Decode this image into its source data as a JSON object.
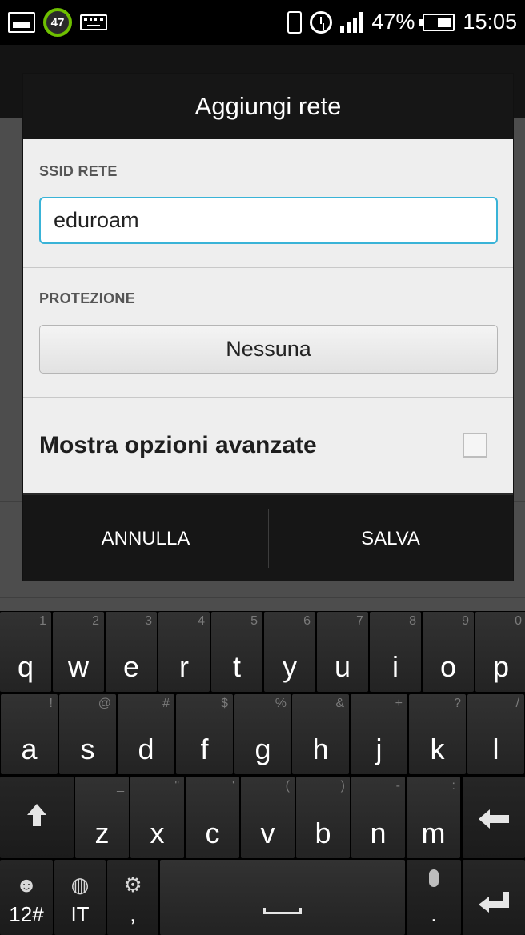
{
  "status_bar": {
    "notification_count": "47",
    "battery_percent": "47%",
    "time": "15:05",
    "icons": [
      "image-icon",
      "task-counter-icon",
      "keyboard-icon",
      "vibrate-icon",
      "alarm-icon",
      "signal-icon",
      "battery-icon"
    ]
  },
  "dialog": {
    "title": "Aggiungi rete",
    "ssid_label": "SSID RETE",
    "ssid_value": "eduroam",
    "protection_label": "PROTEZIONE",
    "protection_value": "Nessuna",
    "advanced_label": "Mostra opzioni avanzate",
    "advanced_checked": false,
    "cancel_label": "ANNULLA",
    "save_label": "SALVA"
  },
  "keyboard": {
    "row1": [
      {
        "k": "q",
        "s": "1"
      },
      {
        "k": "w",
        "s": "2"
      },
      {
        "k": "e",
        "s": "3"
      },
      {
        "k": "r",
        "s": "4"
      },
      {
        "k": "t",
        "s": "5"
      },
      {
        "k": "y",
        "s": "6"
      },
      {
        "k": "u",
        "s": "7"
      },
      {
        "k": "i",
        "s": "8"
      },
      {
        "k": "o",
        "s": "9"
      },
      {
        "k": "p",
        "s": "0"
      }
    ],
    "row2": [
      {
        "k": "a",
        "s": "!"
      },
      {
        "k": "s",
        "s": "@"
      },
      {
        "k": "d",
        "s": "#"
      },
      {
        "k": "f",
        "s": "$"
      },
      {
        "k": "g",
        "s": "%"
      },
      {
        "k": "h",
        "s": "&"
      },
      {
        "k": "j",
        "s": "+"
      },
      {
        "k": "k",
        "s": "?"
      },
      {
        "k": "l",
        "s": "/"
      }
    ],
    "row3": [
      {
        "k": "z",
        "s": "_"
      },
      {
        "k": "x",
        "s": "\""
      },
      {
        "k": "c",
        "s": "'"
      },
      {
        "k": "v",
        "s": "("
      },
      {
        "k": "b",
        "s": ")"
      },
      {
        "k": "n",
        "s": "-"
      },
      {
        "k": "m",
        "s": ":"
      }
    ],
    "symbols_label": "12#",
    "language_label": "IT",
    "settings_sub": ",",
    "mic_sub": "."
  }
}
